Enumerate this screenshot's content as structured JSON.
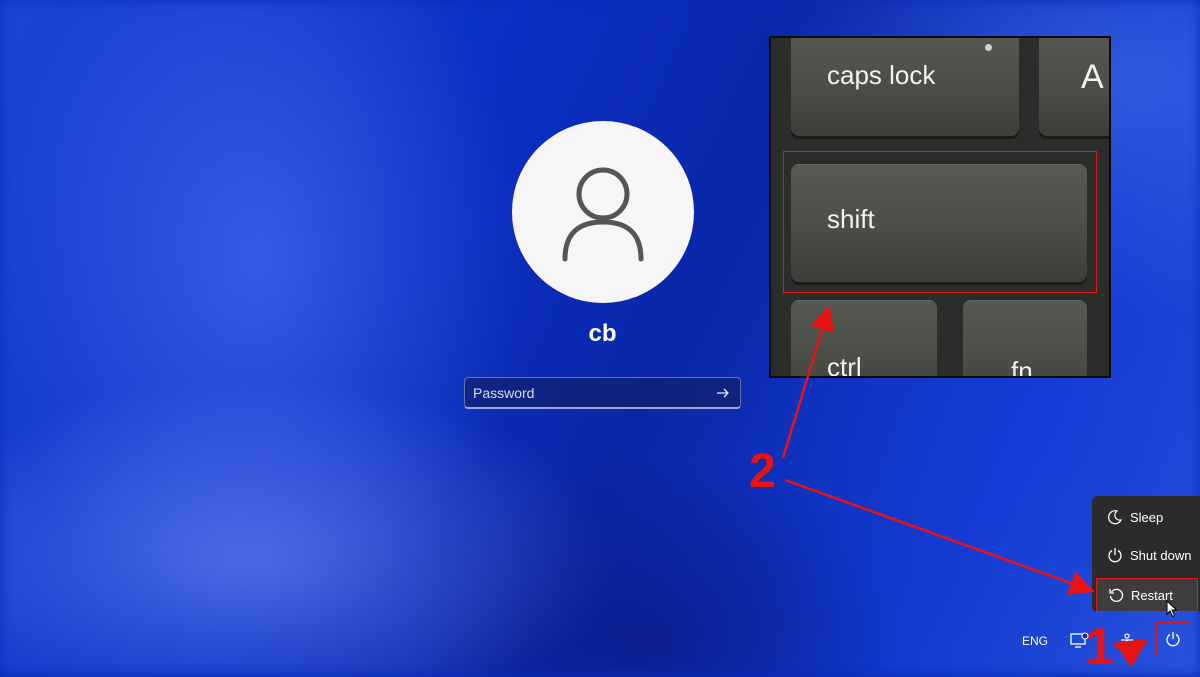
{
  "user": {
    "name": "cb"
  },
  "password": {
    "placeholder": "Password"
  },
  "keyboard": {
    "keys": [
      "caps lock",
      "A",
      "shift",
      "ctrl",
      "fn"
    ]
  },
  "power_menu": {
    "items": [
      {
        "label": "Sleep",
        "icon": "moon-icon"
      },
      {
        "label": "Shut down",
        "icon": "power-icon"
      },
      {
        "label": "Restart",
        "icon": "restart-icon"
      }
    ]
  },
  "tray": {
    "language": "ENG"
  },
  "annotations": {
    "step1": "1",
    "step2": "2",
    "highlight_color": "#e01818"
  }
}
